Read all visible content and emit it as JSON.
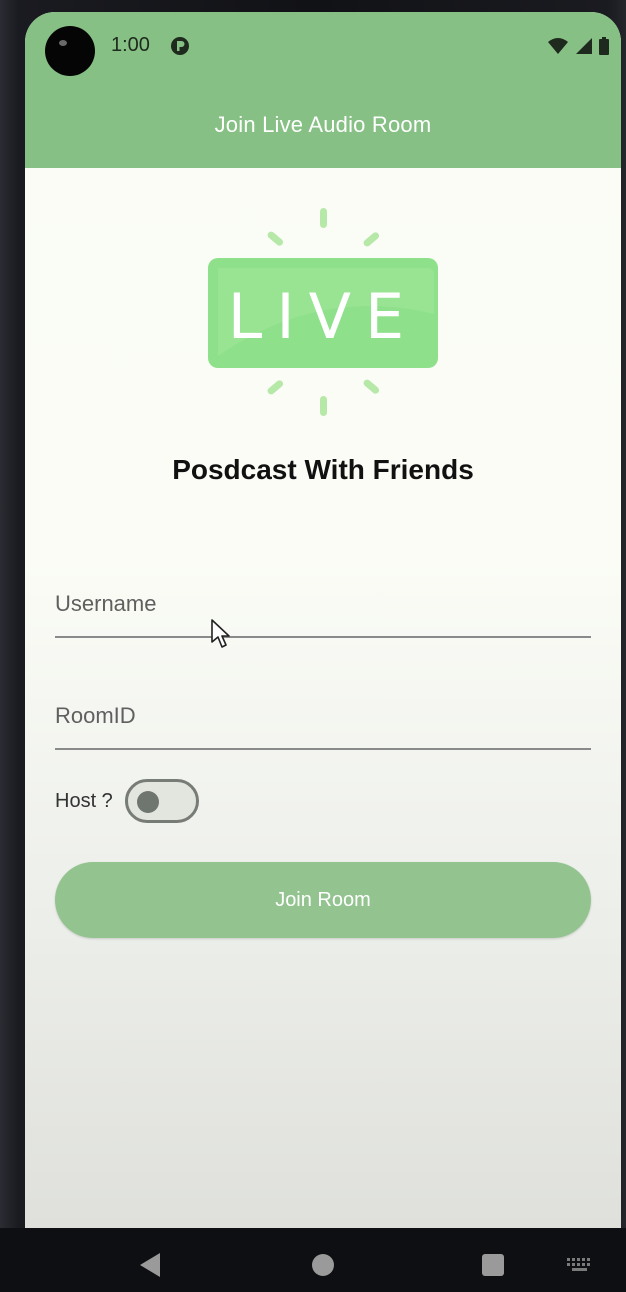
{
  "status_bar": {
    "time": "1:00",
    "icons": [
      "wifi-icon",
      "signal-icon",
      "battery-icon"
    ]
  },
  "appbar": {
    "title": "Join Live Audio Room",
    "color": "#86c084"
  },
  "logo": {
    "text": "LIVE",
    "color": "#8ee08a"
  },
  "headline": "Posdcast With Friends",
  "form": {
    "username": {
      "placeholder": "Username",
      "value": ""
    },
    "room_id": {
      "placeholder": "RoomID",
      "value": ""
    },
    "host": {
      "label": "Host ?",
      "checked": false
    },
    "join_label": "Join Room",
    "join_color": "#93c490"
  },
  "nav_bar": {
    "icons": [
      "back-icon",
      "home-icon",
      "recents-icon",
      "keyboard-icon"
    ]
  }
}
